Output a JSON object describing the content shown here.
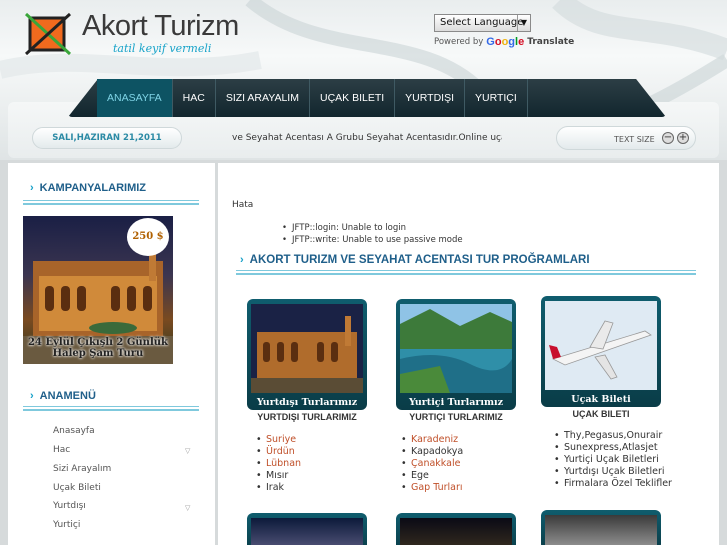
{
  "header": {
    "brand": "Akort Turizm",
    "slogan": "tatil keyif vermeli",
    "language_select": "Select Language",
    "powered_by": "Powered by",
    "google": [
      "G",
      "o",
      "o",
      "g",
      "l",
      "e"
    ],
    "translate": "Translate"
  },
  "nav": [
    "ANASAYFA",
    "HAC",
    "SIZI ARAYALIM",
    "UÇAK BILETI",
    "YURTDIŞI",
    "YURTIÇI"
  ],
  "subbar": {
    "date": "SALI,HAZIRAN 21,2011",
    "ticker": "ve Seyahat Acentası A Grubu Seyahat Acentasıdır.Online uçak bi",
    "text_size": "TEXT SIZE",
    "minus": "−",
    "plus": "+"
  },
  "sidebar": {
    "campaigns_title": "KAMPANYALARIMIZ",
    "promo_price": "250 $",
    "promo_line1": "24 Eylül Çıkışlı 2 Günlük",
    "promo_line2": "Halep Şam Turu",
    "menu_title": "ANAMENÜ",
    "menu": [
      "Anasayfa",
      "Hac",
      "Sizi Arayalım",
      "Uçak Bileti",
      "Yurtdışı",
      "Yurtiçi"
    ]
  },
  "main": {
    "error_title": "Hata",
    "errors": [
      "JFTP::login: Unable to login",
      "JFTP::write: Unable to use passive mode"
    ],
    "section_title": "AKORT TURIZM VE SEYAHAT ACENTASI TUR PROĞRAMLARI",
    "cards": [
      {
        "label": "Yurtdışı Turlarımız",
        "title": "YURTDIŞI TURLARIMIZ",
        "items": [
          {
            "t": "Suriye",
            "link": true
          },
          {
            "t": "Ürdün",
            "link": true
          },
          {
            "t": "Lübnan",
            "link": true
          },
          {
            "t": "Mısır",
            "link": false
          },
          {
            "t": "Irak",
            "link": false
          }
        ]
      },
      {
        "label": "Yurtiçi Turlarımız",
        "title": "YURTIÇI TURLARIMIZ",
        "items": [
          {
            "t": "Karadeniz",
            "link": true
          },
          {
            "t": "Kapadokya",
            "link": false
          },
          {
            "t": "Çanakkale",
            "link": true
          },
          {
            "t": "Ege",
            "link": false
          },
          {
            "t": "Gap Turları",
            "link": true
          }
        ]
      },
      {
        "label": "Uçak Bileti",
        "title": "UÇAK BILETI",
        "items": [
          {
            "t": "Thy,Pegasus,Onurair",
            "link": false
          },
          {
            "t": "Sunexpress,Atlasjet",
            "link": false
          },
          {
            "t": "Yurtiçi Uçak Biletleri",
            "link": false
          },
          {
            "t": "Yurtdışı Uçak Biletleri",
            "link": false
          },
          {
            "t": "Firmalara Özel Teklifler",
            "link": false
          }
        ]
      }
    ]
  },
  "colors": {
    "accent": "#16a0c8",
    "nav_bg": "#1a2f37",
    "nav_active": "#0d5363",
    "link": "#c0502a"
  }
}
